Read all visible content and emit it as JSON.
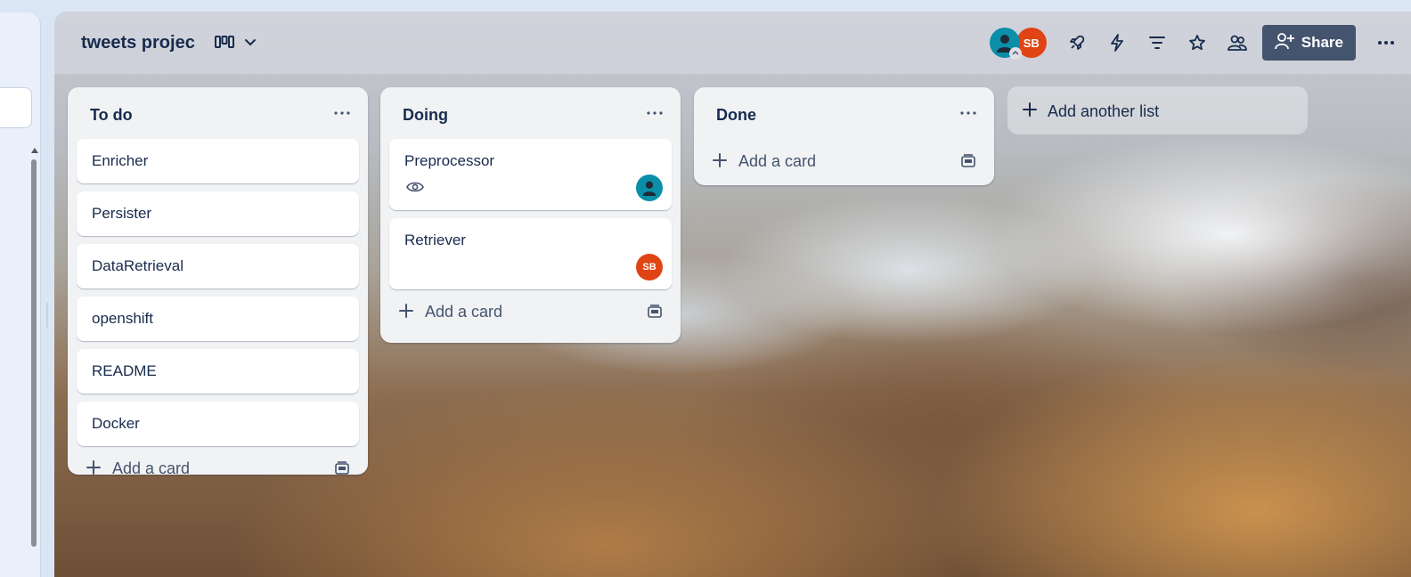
{
  "board": {
    "title": "tweets projec",
    "share_label": "Share"
  },
  "members": [
    {
      "initials": "",
      "color": "#0b8fa8"
    },
    {
      "initials": "SB",
      "color": "#e04414"
    }
  ],
  "lists": [
    {
      "title": "To do",
      "cards": [
        "Enricher",
        "Persister",
        "DataRetrieval",
        "openshift",
        "README",
        "Docker"
      ],
      "add_card_label": "Add a card"
    },
    {
      "title": "Doing",
      "cards": [
        {
          "title": "Preprocessor",
          "watching": true,
          "member": "teal"
        },
        {
          "title": "Retriever",
          "member_initials": "SB"
        }
      ],
      "add_card_label": "Add a card"
    },
    {
      "title": "Done",
      "cards": [],
      "add_card_label": "Add a card"
    }
  ],
  "add_list_label": "Add another list",
  "icons": {
    "view": "board-view-icon",
    "chevron": "chevron-down-icon",
    "power_ups": "rocket-icon",
    "automation": "lightning-icon",
    "filter": "filter-icon",
    "star": "star-icon",
    "visibility": "team-visibility-icon",
    "share": "add-person-icon",
    "more": "more-icon"
  },
  "colors": {
    "accent_dark": "#172b4d",
    "share_bg": "#44546f",
    "list_bg": "#f1f2f4"
  }
}
